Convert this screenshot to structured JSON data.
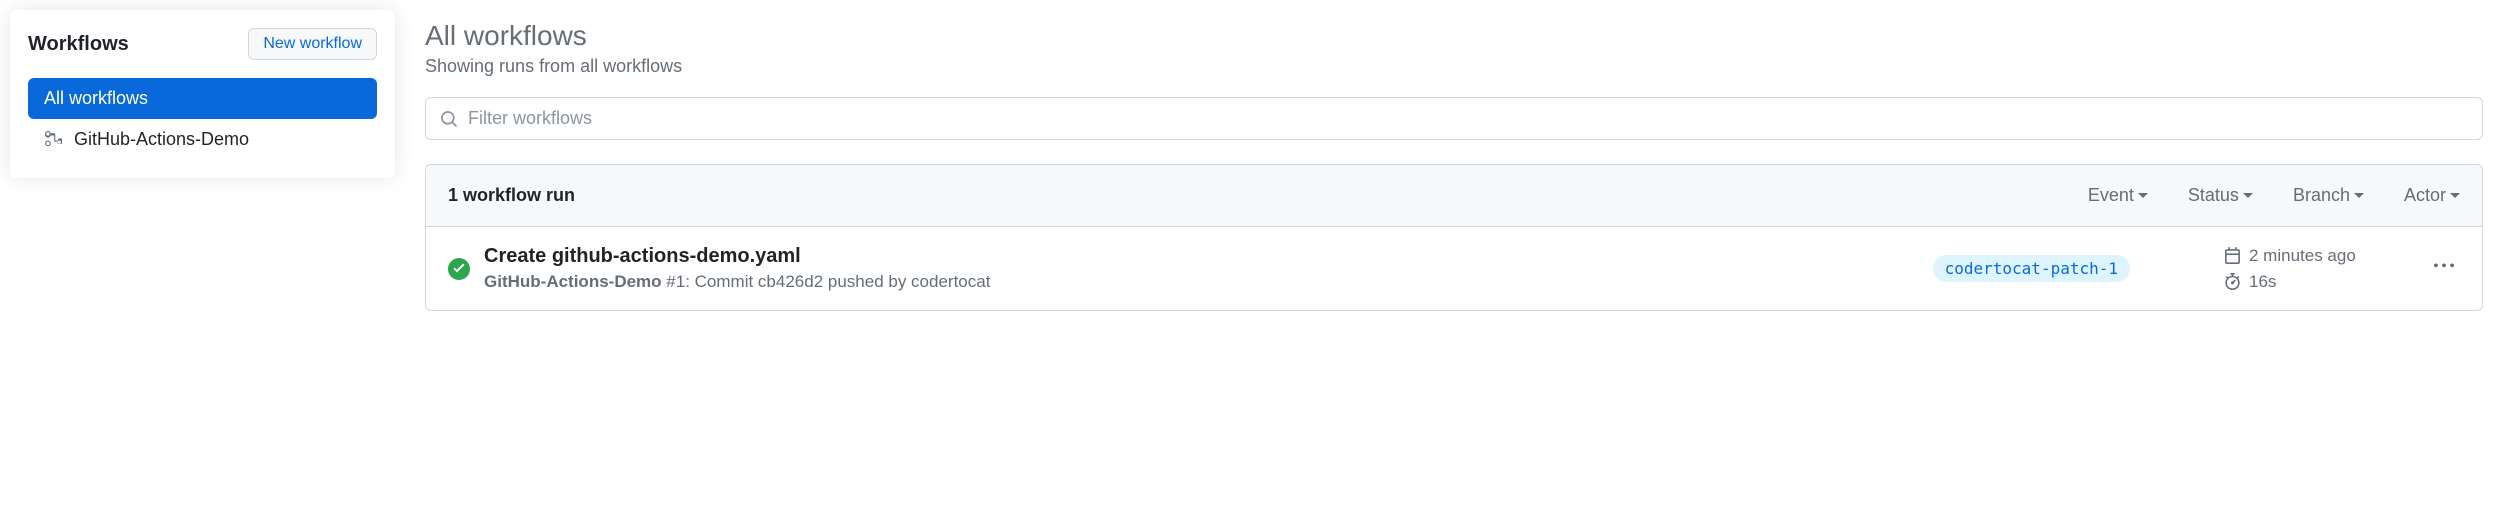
{
  "sidebar": {
    "title": "Workflows",
    "new_button": "New workflow",
    "items": [
      {
        "label": "All workflows",
        "active": true
      },
      {
        "label": "GitHub-Actions-Demo",
        "active": false
      }
    ]
  },
  "page": {
    "title": "All workflows",
    "subtitle": "Showing runs from all workflows"
  },
  "filter": {
    "placeholder": "Filter workflows"
  },
  "runs_header": {
    "count_label": "1 workflow run",
    "filters": {
      "event": "Event",
      "status": "Status",
      "branch": "Branch",
      "actor": "Actor"
    }
  },
  "runs": [
    {
      "status": "success",
      "title": "Create github-actions-demo.yaml",
      "workflow_name": "GitHub-Actions-Demo",
      "run_number": "#1",
      "meta_text": ": Commit cb426d2 pushed by codertocat",
      "branch": "codertocat-patch-1",
      "time_ago": "2 minutes ago",
      "duration": "16s"
    }
  ]
}
